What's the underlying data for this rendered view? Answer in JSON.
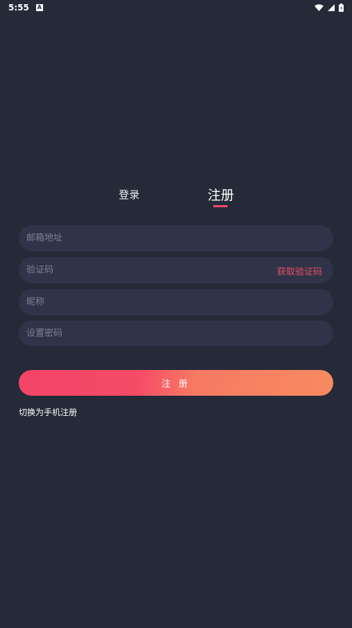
{
  "status_bar": {
    "time": "5:55",
    "notification_icon_letter": "A",
    "icons": [
      "wifi-icon",
      "signal-icon",
      "battery-icon"
    ]
  },
  "tabs": {
    "login_label": "登录",
    "register_label": "注册",
    "active": "register"
  },
  "form": {
    "email_placeholder": "邮箱地址",
    "code_placeholder": "验证码",
    "get_code_label": "获取验证码",
    "nickname_placeholder": "昵称",
    "password_placeholder": "设置密码"
  },
  "register_button_label": "注 册",
  "switch_label": "切换为手机注册",
  "colors": {
    "background": "#252a38",
    "field_background": "#2f3448",
    "accent": "#f34d6b",
    "gradient_start": "#f34468",
    "gradient_end": "#f88a60"
  }
}
